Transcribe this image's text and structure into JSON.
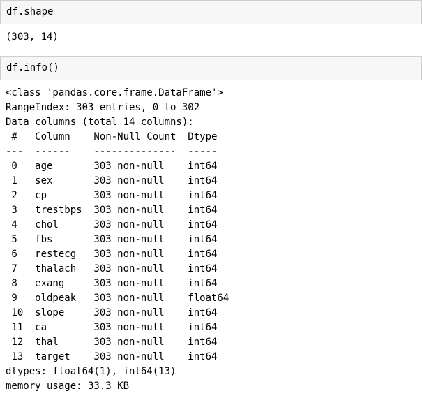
{
  "cell1": {
    "input": "df.shape",
    "output": "(303, 14)"
  },
  "cell2": {
    "input": "df.info()",
    "output_line_class": "<class 'pandas.core.frame.DataFrame'>",
    "output_line_range": "RangeIndex: 303 entries, 0 to 302",
    "output_line_datacols": "Data columns (total 14 columns):",
    "header_row": " #   Column    Non-Null Count  Dtype  ",
    "divider_row": "---  ------    --------------  -----  ",
    "rows": [
      " 0   age       303 non-null    int64  ",
      " 1   sex       303 non-null    int64  ",
      " 2   cp        303 non-null    int64  ",
      " 3   trestbps  303 non-null    int64  ",
      " 4   chol      303 non-null    int64  ",
      " 5   fbs       303 non-null    int64  ",
      " 6   restecg   303 non-null    int64  ",
      " 7   thalach   303 non-null    int64  ",
      " 8   exang     303 non-null    int64  ",
      " 9   oldpeak   303 non-null    float64",
      " 10  slope     303 non-null    int64  ",
      " 11  ca        303 non-null    int64  ",
      " 12  thal      303 non-null    int64  ",
      " 13  target    303 non-null    int64  "
    ],
    "output_line_dtypes": "dtypes: float64(1), int64(13)",
    "output_line_mem": "memory usage: 33.3 KB"
  }
}
